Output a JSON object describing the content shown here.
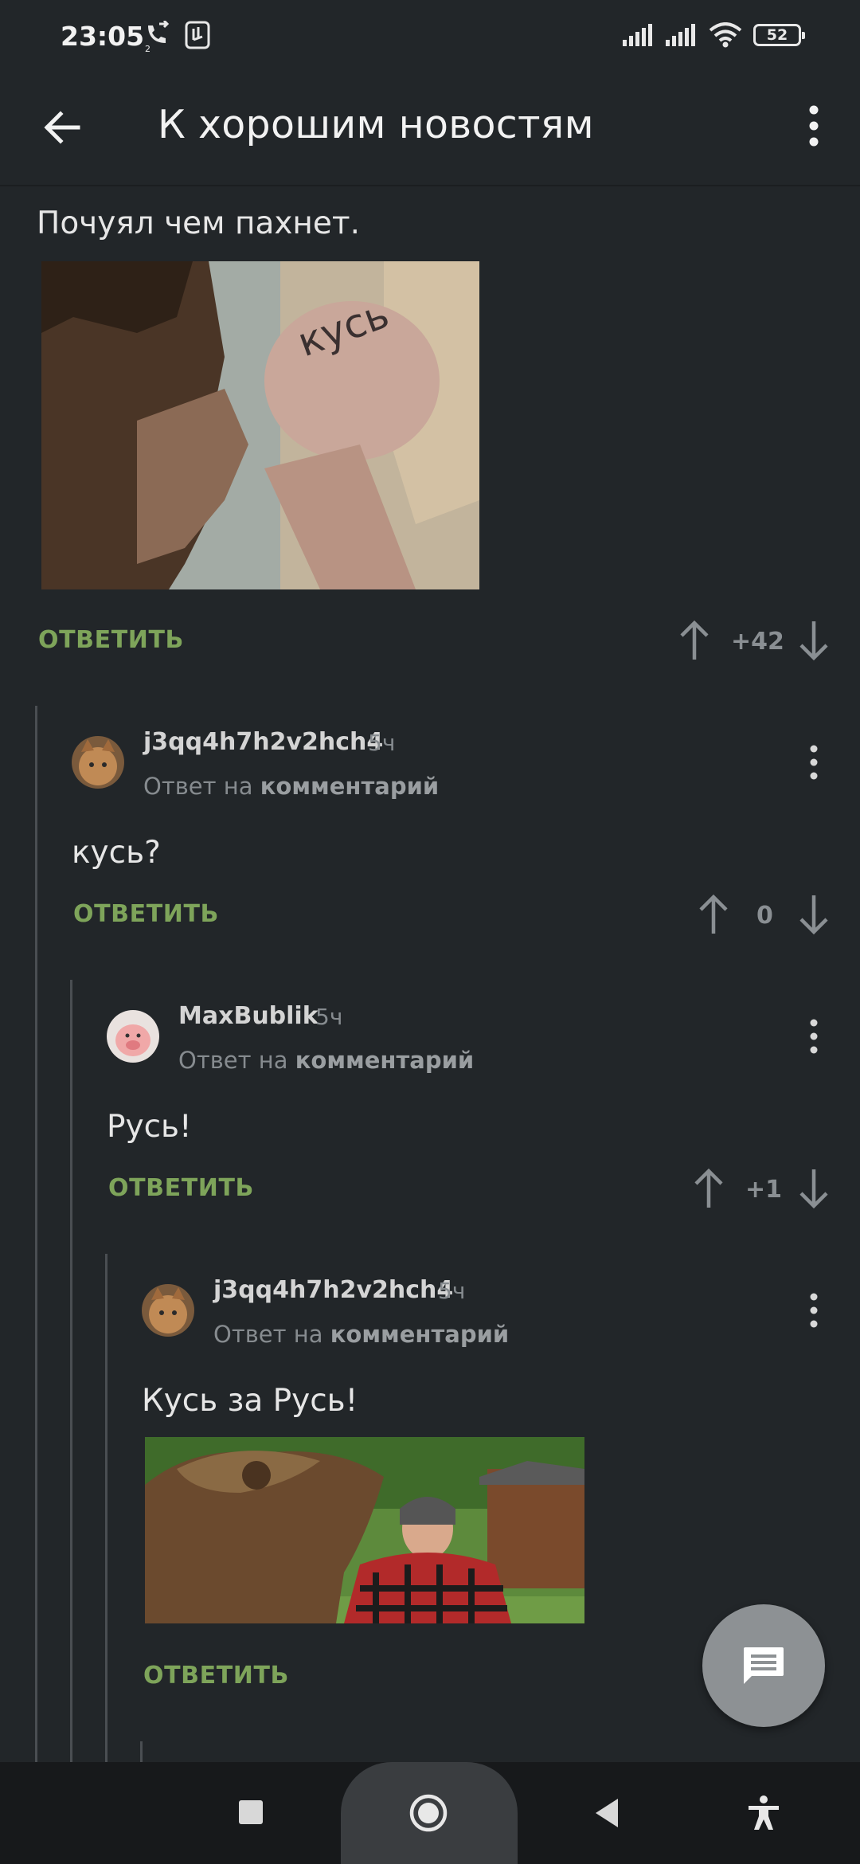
{
  "status": {
    "time": "23:05",
    "battery": "52"
  },
  "appbar": {
    "title": "К хорошим новостям"
  },
  "post": {
    "text": "Почуял чем пахнет.",
    "reply_label": "ОТВЕТИТЬ",
    "score": "+42"
  },
  "comments": [
    {
      "user": "j3qq4h7h2v2hch4",
      "time": "5ч",
      "reply_prefix": "Ответ на",
      "reply_target": "комментарий",
      "text": "кусь?",
      "reply_label": "ОТВЕТИТЬ",
      "score": "0"
    },
    {
      "user": "MaxBublik",
      "time": "5ч",
      "reply_prefix": "Ответ на",
      "reply_target": "комментарий",
      "text": "Русь!",
      "reply_label": "ОТВЕТИТЬ",
      "score": "+1"
    },
    {
      "user": "j3qq4h7h2v2hch4",
      "time": "5ч",
      "reply_prefix": "Ответ на",
      "reply_target": "комментарий",
      "text": "Кусь за Русь!",
      "reply_label": "ОТВЕТИТЬ"
    }
  ],
  "icons": {
    "back": "arrow-back-icon",
    "menu": "more-vert-icon",
    "upvote": "arrow-up-icon",
    "downvote": "arrow-down-icon",
    "fab": "comment-icon"
  },
  "colors": {
    "background": "#222629",
    "accent": "#7ea45a",
    "muted": "#868b8f"
  }
}
